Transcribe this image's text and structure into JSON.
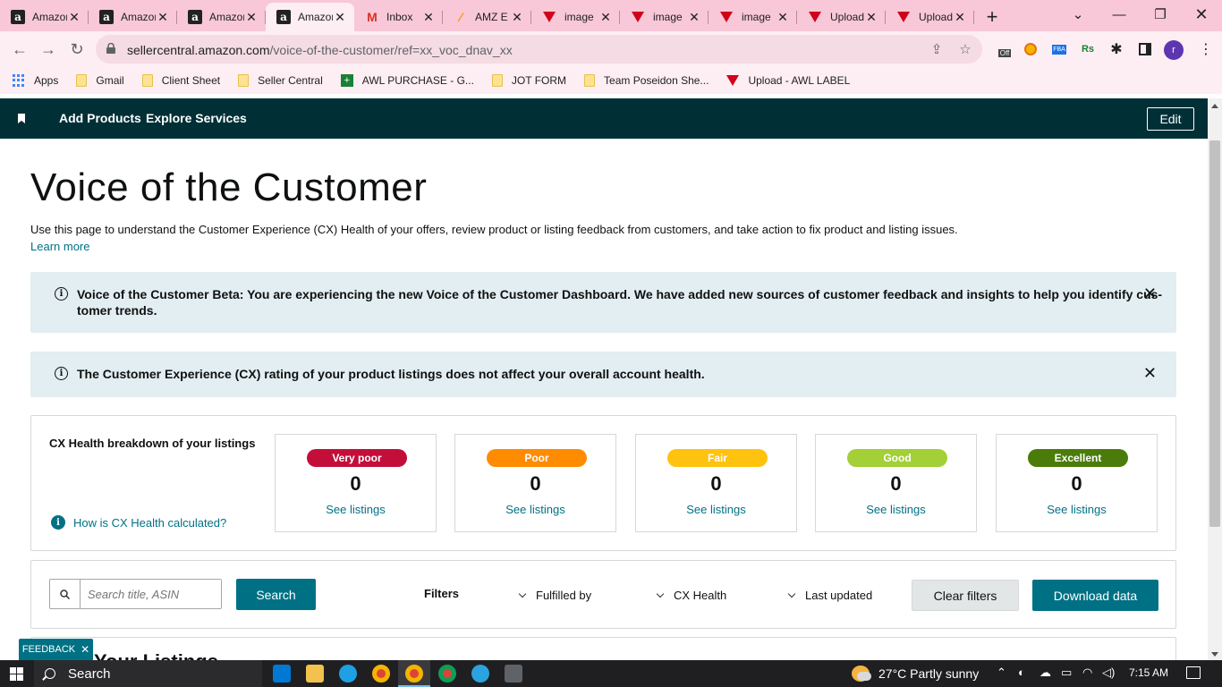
{
  "browser": {
    "tabs": [
      {
        "title": "Amazon",
        "icon": "amazon-a-icon",
        "active": false
      },
      {
        "title": "Amazon",
        "icon": "amazon-a-icon",
        "active": false
      },
      {
        "title": "Amazon",
        "icon": "amazon-a-icon",
        "active": false
      },
      {
        "title": "Amazon",
        "icon": "amazon-a-icon",
        "active": true
      },
      {
        "title": "Inbox",
        "icon": "gmail-icon",
        "active": false
      },
      {
        "title": "AMZ E",
        "icon": "amz-tool-icon",
        "active": false
      },
      {
        "title": "image",
        "icon": "red-triangle-icon",
        "active": false
      },
      {
        "title": "image",
        "icon": "red-triangle-icon",
        "active": false
      },
      {
        "title": "image",
        "icon": "red-triangle-icon",
        "active": false
      },
      {
        "title": "Upload",
        "icon": "red-triangle-icon",
        "active": false
      },
      {
        "title": "Upload",
        "icon": "red-triangle-icon",
        "active": false
      }
    ],
    "new_tab": "+",
    "url_domain": "sellercentral.amazon.com",
    "url_path": "/voice-of-the-customer/ref=xx_voc_dnav_xx",
    "ext_off_label": "Off",
    "ext_fba_label": "FBA",
    "ext_rs_label": "Rs",
    "profile_initial": "r",
    "bookmarks": [
      {
        "label": "Apps",
        "icon": "apps-grid-icon"
      },
      {
        "label": "Gmail",
        "icon": "folder-icon"
      },
      {
        "label": "Client Sheet",
        "icon": "folder-icon"
      },
      {
        "label": "Seller Central",
        "icon": "folder-icon"
      },
      {
        "label": "AWL PURCHASE - G...",
        "icon": "sheets-icon"
      },
      {
        "label": "JOT FORM",
        "icon": "folder-icon"
      },
      {
        "label": "Team Poseidon She...",
        "icon": "folder-icon"
      },
      {
        "label": "Upload - AWL LABEL",
        "icon": "red-triangle-icon"
      }
    ]
  },
  "topnav": {
    "add_products": "Add Products",
    "explore_services": "Explore Services",
    "edit": "Edit"
  },
  "page": {
    "title": "Voice of the Customer",
    "intro": "Use this page to understand the Customer Experience (CX) Health of your offers, review product or listing feedback from customers, and take action to fix product and listing issues.",
    "learn_more": "Learn more",
    "alert_beta_line1": "Voice of the Customer Beta: You are experiencing the new Voice of the Customer Dashboard. We have added new sources of customer feedback and insights to help you identify cus-",
    "alert_beta_line2": "tomer trends.",
    "alert_cx": "The Customer Experience (CX) rating of your product listings does not affect your overall account health.",
    "cx_label": "CX Health breakdown of your listings",
    "how_link": "How is CX Health calculated?",
    "cards": [
      {
        "label": "Very poor",
        "count": "0",
        "link": "See listings",
        "color": "#c40e3a"
      },
      {
        "label": "Poor",
        "count": "0",
        "link": "See listings",
        "color": "#ff8c00"
      },
      {
        "label": "Fair",
        "count": "0",
        "link": "See listings",
        "color": "#ffc20e"
      },
      {
        "label": "Good",
        "count": "0",
        "link": "See listings",
        "color": "#a3cf37"
      },
      {
        "label": "Excellent",
        "count": "0",
        "link": "See listings",
        "color": "#4b7b0a"
      }
    ],
    "search_placeholder": "Search title, ASIN",
    "search_button": "Search",
    "filters_label": "Filters",
    "filter_fulfilled": "Fulfilled by",
    "filter_cx": "CX Health",
    "filter_updated": "Last updated",
    "clear_filters": "Clear filters",
    "download": "Download data",
    "next_heading": "Your Listings",
    "feedback": "FEEDBACK"
  },
  "taskbar": {
    "search": "Search",
    "weather": "27°C  Partly sunny",
    "time": "7:15 AM"
  },
  "colors": {
    "nav_bg": "#002f36",
    "teal": "#007185",
    "alert_bg": "#e2eef1",
    "tab_strip": "#f8c8d8"
  }
}
